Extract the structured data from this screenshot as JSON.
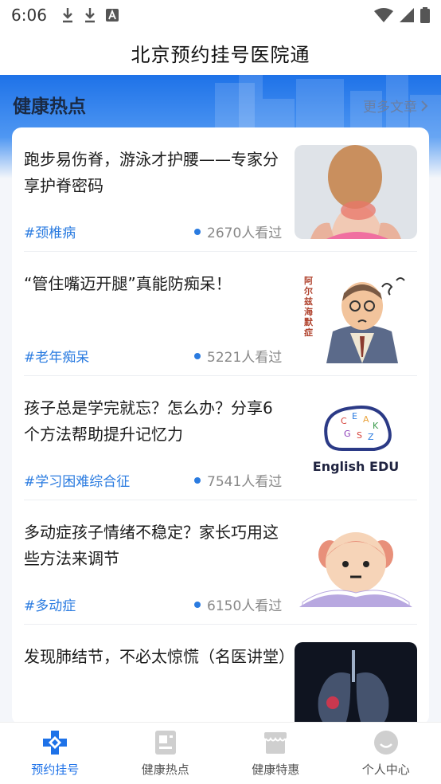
{
  "status_bar": {
    "time": "6:06",
    "left_icons": [
      "download-icon",
      "download-icon",
      "a-badge-icon"
    ],
    "right_icons": [
      "wifi-icon",
      "signal-icon",
      "battery-icon"
    ]
  },
  "app_bar": {
    "title": "北京预约挂号医院通"
  },
  "section": {
    "title": "健康热点",
    "more_label": "更多文章"
  },
  "articles": [
    {
      "title": "跑步易伤脊，游泳才护腰——专家分享护脊密码",
      "tag": "#颈椎病",
      "views": "2670人看过"
    },
    {
      "title": "“管住嘴迈开腿”真能防痴呆！",
      "tag": "#老年痴呆",
      "views": "5221人看过"
    },
    {
      "title": "孩子总是学完就忘？怎么办？分享6个方法帮助提升记忆力",
      "tag": "#学习困难综合征",
      "views": "7541人看过"
    },
    {
      "title": "多动症孩子情绪不稳定？家长巧用这些方法来调节",
      "tag": "#多动症",
      "views": "6150人看过"
    },
    {
      "title": "发现肺结节，不必太惊慌（名医讲堂）",
      "tag": "",
      "views": ""
    }
  ],
  "thumb_text": {
    "alzheimer_label": "阿尔兹海默症",
    "edu_label": "English EDU"
  },
  "bottom_nav": {
    "items": [
      {
        "label": "预约挂号",
        "icon": "hospital-cross-icon",
        "active": true
      },
      {
        "label": "健康热点",
        "icon": "news-icon",
        "active": false
      },
      {
        "label": "健康特惠",
        "icon": "shop-icon",
        "active": false
      },
      {
        "label": "个人中心",
        "icon": "smile-icon",
        "active": false
      }
    ]
  },
  "colors": {
    "accent": "#1e72e8",
    "tag": "#2a7be0",
    "banner_top": "#1e72e8"
  }
}
